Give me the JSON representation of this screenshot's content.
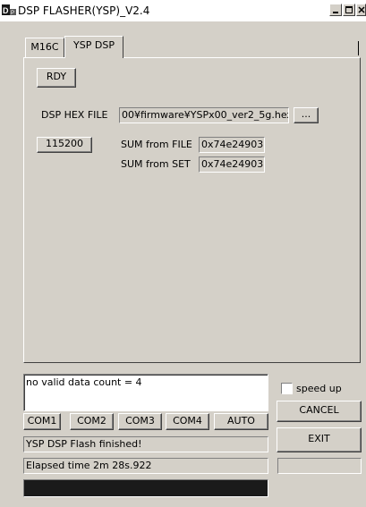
{
  "window": {
    "title": "DSP FLASHER(YSP)_V2.4",
    "app_icon": "dsp-app-icon"
  },
  "caption_buttons": [
    "minimize",
    "maximize",
    "close"
  ],
  "tabs": [
    {
      "label": "M16C",
      "selected": false
    },
    {
      "label": "YSP DSP",
      "selected": true
    }
  ],
  "panel": {
    "rdy_label": "RDY",
    "hex_file_label": "DSP HEX FILE",
    "hex_file_value": "00¥firmware¥YSPx00_ver2_5g.hex",
    "browse_label": "...",
    "baud_label": "115200",
    "sum_file_label": "SUM from FILE",
    "sum_file_value": "0x74e24903",
    "sum_set_label": "SUM from SET",
    "sum_set_value": "0x74e24903"
  },
  "log": {
    "message": "no valid data count = 4"
  },
  "speed_up": {
    "label": "speed up",
    "checked": false
  },
  "com_buttons": [
    "COM1",
    "COM2",
    "COM3",
    "COM4",
    "AUTO"
  ],
  "cancel_label": "CANCEL",
  "exit_label": "EXIT",
  "status": {
    "message": "YSP DSP Flash finished!",
    "elapsed": "Elapsed time 2m 28s.922",
    "side_value": ""
  },
  "progress": {
    "fraction": 1.0,
    "color": "#1a1a1a"
  }
}
